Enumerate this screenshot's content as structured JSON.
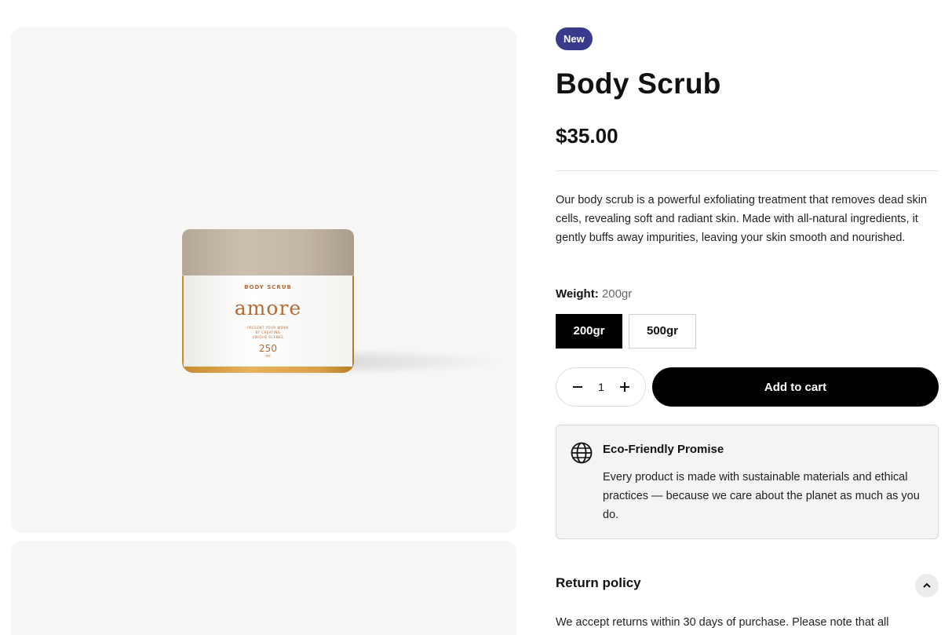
{
  "product": {
    "badge": "New",
    "title": "Body Scrub",
    "price": "$35.00",
    "description": "Our body scrub is a powerful exfoliating treatment that removes dead skin cells, revealing soft and radiant skin. Made with all-natural ingredients, it gently buffs away impurities, leaving your skin smooth and nourished.",
    "image_label": {
      "line1": "BODY SCRUB",
      "brand": "amore",
      "line3a": "PRESENT YOUR WORK",
      "line3b": "BY CREATING",
      "line3c": "UNIQUE SCENES",
      "volume": "250",
      "unit": "ml"
    }
  },
  "weight": {
    "label": "Weight:",
    "selected": "200gr",
    "options": [
      "200gr",
      "500gr"
    ]
  },
  "quantity": {
    "value": "1",
    "decrease_icon": "minus-icon",
    "increase_icon": "plus-icon"
  },
  "cart": {
    "add_label": "Add to cart"
  },
  "promise": {
    "icon": "globe-icon",
    "title": "Eco-Friendly Promise",
    "text": "Every product is made with sustainable materials and ethical practices — because we care about the planet as much as you do."
  },
  "return_policy": {
    "title": "Return policy",
    "toggle_icon": "chevron-up-icon",
    "text": "We accept returns within 30 days of purchase. Please note that all"
  },
  "colors": {
    "badge": "#3a3a8c",
    "primary_button": "#000000",
    "gallery_background": "#f6f6f4"
  }
}
